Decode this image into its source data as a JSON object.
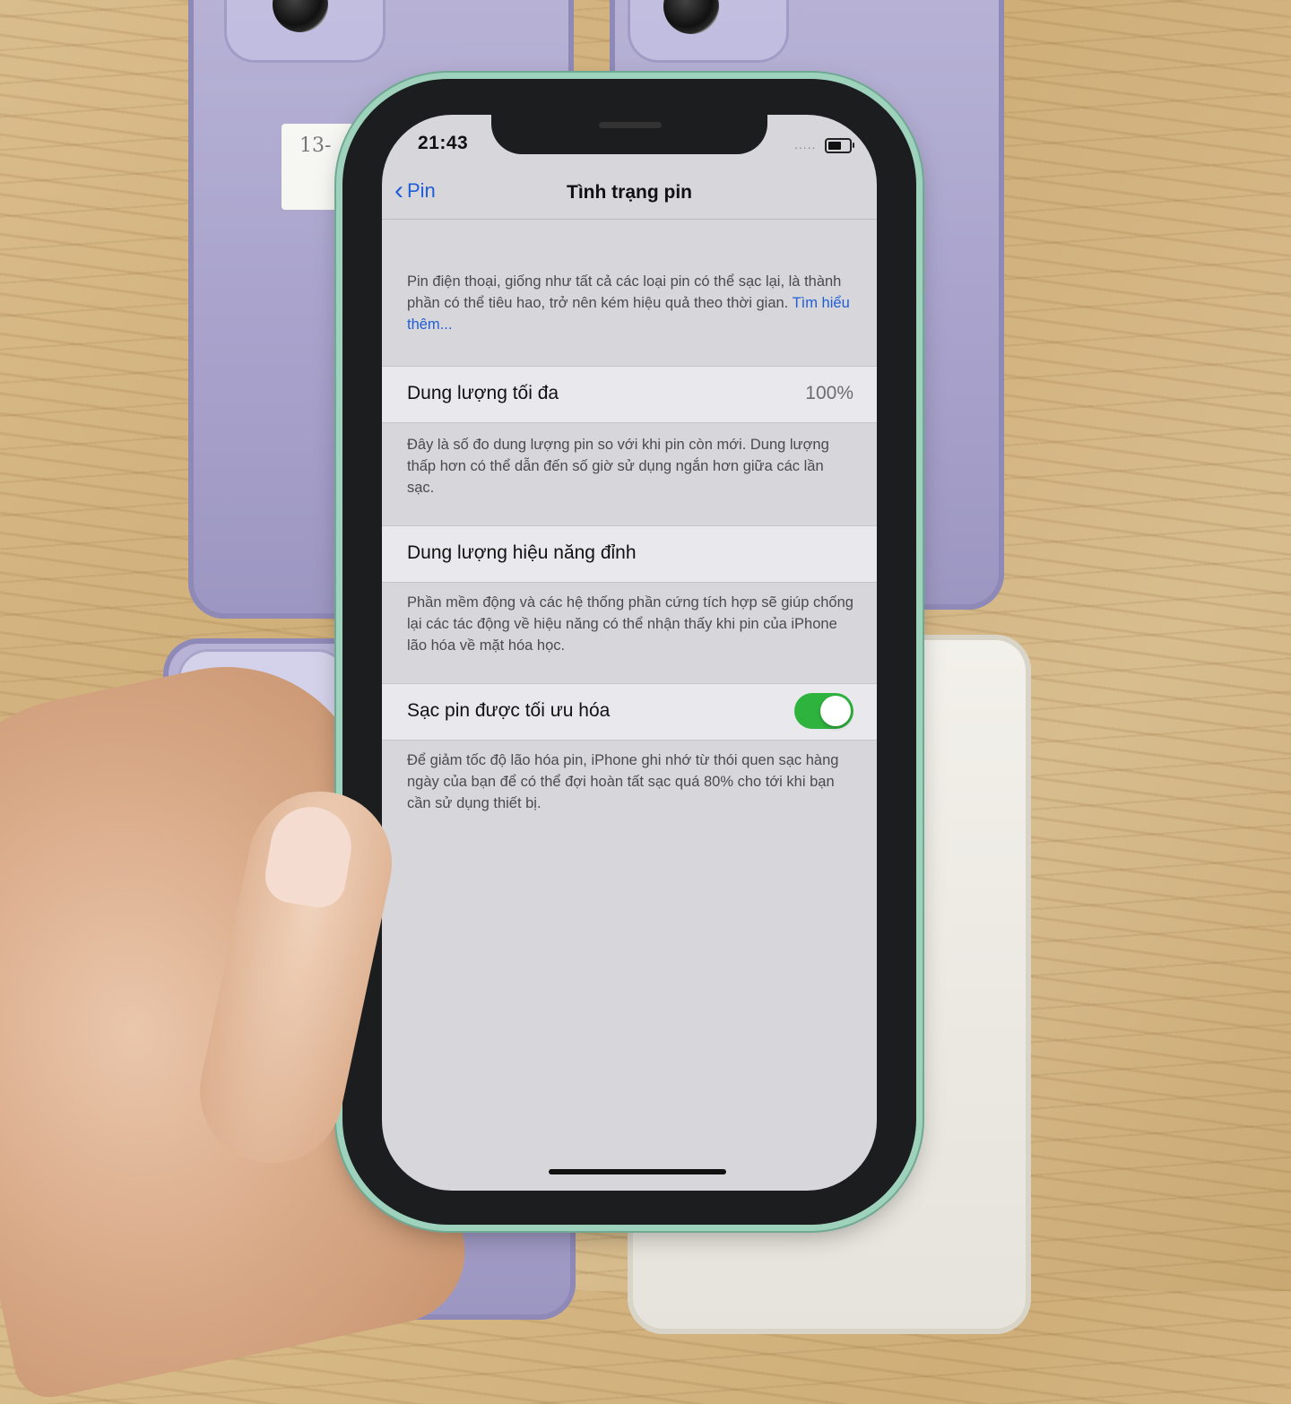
{
  "status_bar": {
    "time": "21:43",
    "signal": "....."
  },
  "nav": {
    "back_label": "Pin",
    "back_chevron": "‹",
    "title": "Tình trạng pin"
  },
  "intro": {
    "text": "Pin điện thoại, giống như tất cả các loại pin có thể sạc lại, là thành phần có thể tiêu hao, trở nên kém hiệu quả theo thời gian. ",
    "link": "Tìm hiểu thêm..."
  },
  "max_capacity": {
    "label": "Dung lượng tối đa",
    "value": "100%",
    "note": "Đây là số đo dung lượng pin so với khi pin còn mới. Dung lượng thấp hơn có thể dẫn đến số giờ sử dụng ngắn hơn giữa các lần sạc."
  },
  "peak_performance": {
    "label": "Dung lượng hiệu năng đỉnh",
    "note": "Phần mềm động và các hệ thống phần cứng tích hợp sẽ giúp chống lại các tác động về hiệu năng có thể nhận thấy khi pin của iPhone lão hóa về mặt hóa học."
  },
  "optimized_charging": {
    "label": "Sạc pin được tối ưu hóa",
    "enabled": true,
    "note": "Để giảm tốc độ lão hóa pin, iPhone ghi nhớ từ thói quen sạc hàng ngày của bạn để có thể đợi hoàn tất sạc quá 80% cho tới khi bạn cần sử dụng thiết bị."
  },
  "background_label_card": "13-",
  "colors": {
    "accent": "#1f5ed6",
    "toggle_on": "#2fb33f",
    "phone_frame": "#9fd2bd"
  }
}
